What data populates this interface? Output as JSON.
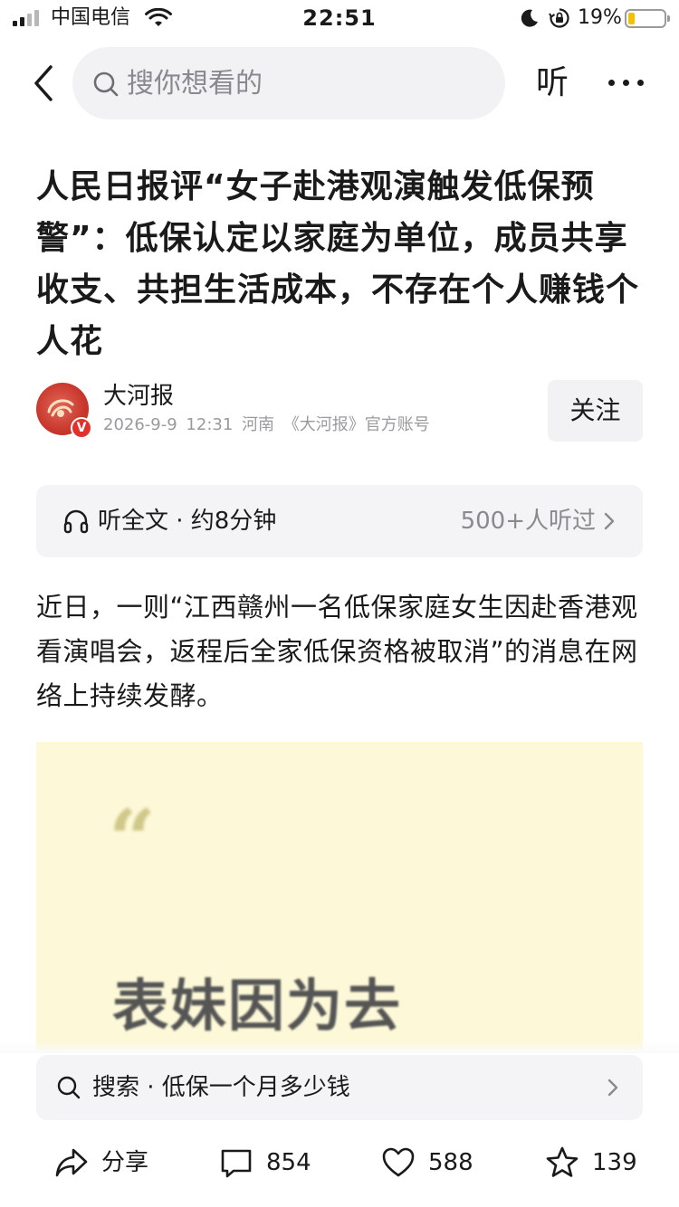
{
  "status_bar": {
    "carrier": "中国电信",
    "time": "22:51",
    "battery_percent": "19%",
    "battery_level": 0.19,
    "icons": [
      "signal-icon",
      "wifi-icon",
      "moon-icon",
      "rotation-lock-icon",
      "battery-icon"
    ]
  },
  "nav": {
    "back_icon": "chevron-left-icon",
    "search_placeholder": "搜你想看的",
    "listen_label": "听",
    "more_icon": "more-dots-icon"
  },
  "article": {
    "title": "人民日报评“女子赴港观演触发低保预警”：低保认定以家庭为单位，成员共享收支、共担生活成本，不存在个人赚钱个人花",
    "author": {
      "name": "大河报",
      "meta": "2026-9-9  12:31  河南  《大河报》官方账号",
      "verified_badge": "V",
      "follow_label": "关注"
    },
    "listen_bar": {
      "label": "听全文 · 约8分钟",
      "count": "500+人听过"
    },
    "paragraph": "近日，一则“江西赣州一名低保家庭女生因赴香港观看演唱会，返程后全家低保资格被取消”的消息在网络上持续发酵。",
    "embedded_image": {
      "quote_mark": "“",
      "text": "表妹因为去"
    }
  },
  "bottom": {
    "search_suggestion": "搜索 · 低保一个月多少钱",
    "share_label": "分享",
    "comments": "854",
    "likes": "588",
    "favorites": "139"
  },
  "colors": {
    "accent_red": "#e0322b",
    "battery_yellow": "#f2c200",
    "pill_bg": "#f4f4f6",
    "embed_bg": "#fdf8d8"
  }
}
